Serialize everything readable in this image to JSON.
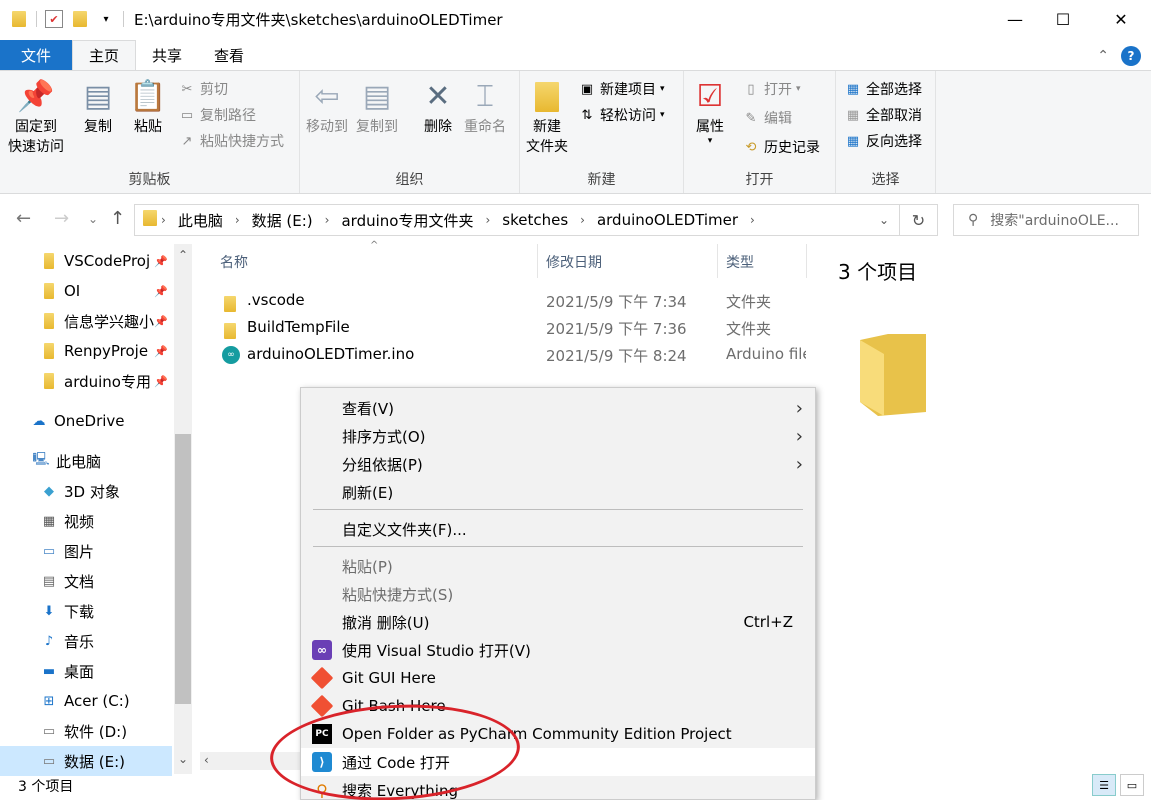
{
  "titlebar": {
    "path": "E:\\arduino专用文件夹\\sketches\\arduinoOLEDTimer",
    "minimize": "—",
    "maximize": "☐",
    "close": "✕"
  },
  "ribbon_tabs": [
    "文件",
    "主页",
    "共享",
    "查看"
  ],
  "ribbon": {
    "clipboard": {
      "label": "剪贴板",
      "pin": "固定到\n快速访问",
      "pin_l1": "固定到",
      "pin_l2": "快速访问",
      "copy": "复制",
      "paste": "粘贴",
      "cut": "剪切",
      "copy_path": "复制路径",
      "paste_shortcut": "粘贴快捷方式"
    },
    "organize": {
      "label": "组织",
      "move_to": "移动到",
      "copy_to": "复制到",
      "delete": "删除",
      "rename": "重命名"
    },
    "new": {
      "label": "新建",
      "new_folder_l1": "新建",
      "new_folder_l2": "文件夹",
      "new_item": "新建项目",
      "easy_access": "轻松访问"
    },
    "open": {
      "label": "打开",
      "properties": "属性",
      "open": "打开",
      "edit": "编辑",
      "history": "历史记录"
    },
    "select": {
      "label": "选择",
      "select_all": "全部选择",
      "select_none": "全部取消",
      "invert": "反向选择"
    }
  },
  "address": {
    "crumbs": [
      "此电脑",
      "数据 (E:)",
      "arduino专用文件夹",
      "sketches",
      "arduinoOLEDTimer"
    ],
    "search_placeholder": "搜索\"arduinoOLE..."
  },
  "sidebar": {
    "quick_access": [
      "VSCodeProj",
      "OI",
      "信息学兴趣小",
      "RenpyProje",
      "arduino专用"
    ],
    "onedrive": "OneDrive",
    "this_pc": "此电脑",
    "pc_items": [
      "3D 对象",
      "视频",
      "图片",
      "文档",
      "下载",
      "音乐",
      "桌面",
      "Acer (C:)",
      "软件 (D:)",
      "数据 (E:)"
    ]
  },
  "file_list": {
    "columns": [
      "名称",
      "修改日期",
      "类型"
    ],
    "rows": [
      {
        "name": ".vscode",
        "date": "2021/5/9 下午 7:34",
        "type": "文件夹"
      },
      {
        "name": "BuildTempFile",
        "date": "2021/5/9 下午 7:36",
        "type": "文件夹"
      },
      {
        "name": "arduinoOLEDTimer.ino",
        "date": "2021/5/9 下午 8:24",
        "type": "Arduino file"
      }
    ]
  },
  "preview": {
    "count": "3 个项目"
  },
  "status": {
    "count": "3 个项目"
  },
  "context_menu": {
    "view": "查看(V)",
    "sort": "排序方式(O)",
    "group": "分组依据(P)",
    "refresh": "刷新(E)",
    "customize": "自定义文件夹(F)...",
    "paste": "粘贴(P)",
    "paste_shortcut": "粘贴快捷方式(S)",
    "undo": "撤消 删除(U)",
    "undo_shortcut": "Ctrl+Z",
    "vs": "使用 Visual Studio 打开(V)",
    "git_gui": "Git GUI Here",
    "git_bash": "Git Bash Here",
    "pycharm": "Open Folder as PyCharm Community Edition Project",
    "vscode": "通过 Code 打开",
    "everything": "搜索 Everything"
  },
  "colors": {
    "file_tab": "#1a73c9",
    "selection": "#cce8ff",
    "annotation": "#d9232a"
  }
}
